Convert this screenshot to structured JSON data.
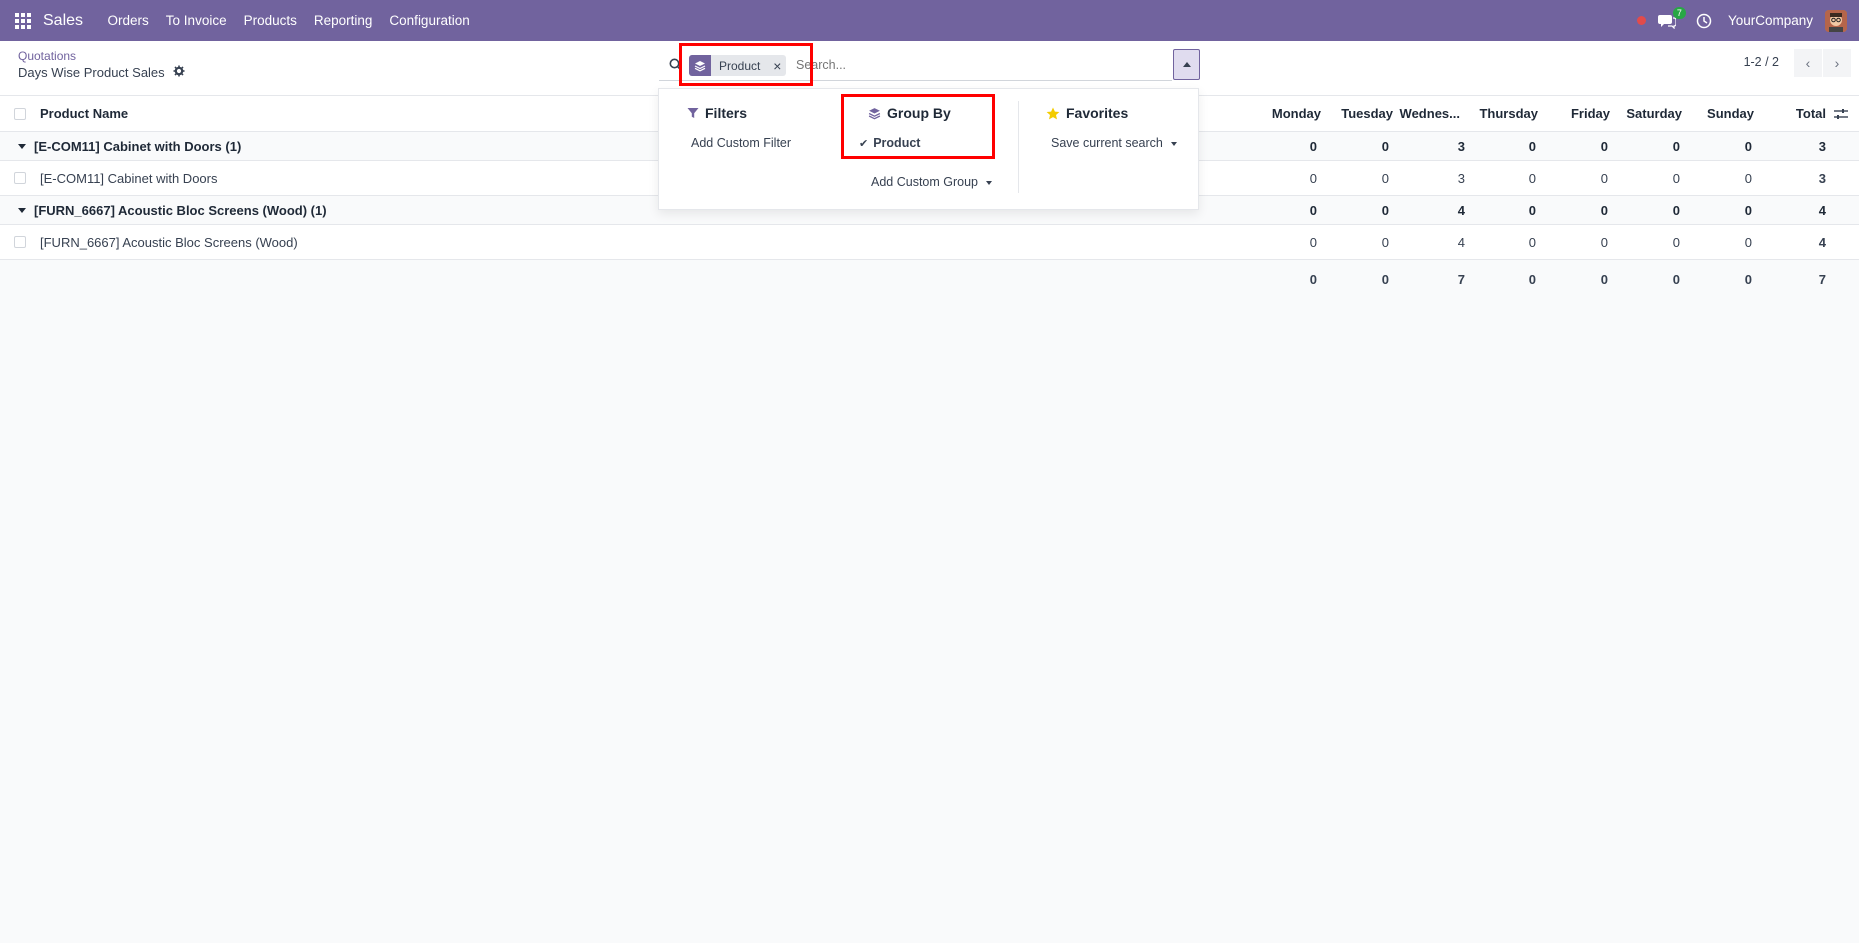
{
  "navbar": {
    "app_name": "Sales",
    "menu": [
      "Orders",
      "To Invoice",
      "Products",
      "Reporting",
      "Configuration"
    ],
    "chat_count": "7",
    "company": "YourCompany",
    "bg_color": "#71639e"
  },
  "control": {
    "breadcrumb": "Quotations",
    "title": "Days Wise Product Sales",
    "search": {
      "facet_label": "Product",
      "placeholder": "Search..."
    },
    "pager": "1-2 / 2"
  },
  "dropdown": {
    "filters": {
      "title": "Filters",
      "items": [
        "Add Custom Filter"
      ]
    },
    "group_by": {
      "title": "Group By",
      "items": [
        "Product"
      ],
      "add_label": "Add Custom Group"
    },
    "favorites": {
      "title": "Favorites",
      "items": [
        "Save current search"
      ]
    }
  },
  "table": {
    "columns": [
      "Product Name",
      "Monday",
      "Tuesday",
      "Wednes...",
      "Thursday",
      "Friday",
      "Saturday",
      "Sunday",
      "Total"
    ],
    "groups": [
      {
        "label": "[E-COM11] Cabinet with Doors (1)",
        "values": [
          "0",
          "0",
          "3",
          "0",
          "0",
          "0",
          "0",
          "3"
        ],
        "rows": [
          {
            "name": "[E-COM11] Cabinet with Doors",
            "values": [
              "0",
              "0",
              "3",
              "0",
              "0",
              "0",
              "0",
              "3"
            ]
          }
        ]
      },
      {
        "label": "[FURN_6667] Acoustic Bloc Screens (Wood) (1)",
        "values": [
          "0",
          "0",
          "4",
          "0",
          "0",
          "0",
          "0",
          "4"
        ],
        "rows": [
          {
            "name": "[FURN_6667] Acoustic Bloc Screens (Wood)",
            "values": [
              "0",
              "0",
              "4",
              "0",
              "0",
              "0",
              "0",
              "4"
            ]
          }
        ]
      }
    ],
    "totals": [
      "0",
      "0",
      "7",
      "0",
      "0",
      "0",
      "0",
      "7"
    ]
  }
}
